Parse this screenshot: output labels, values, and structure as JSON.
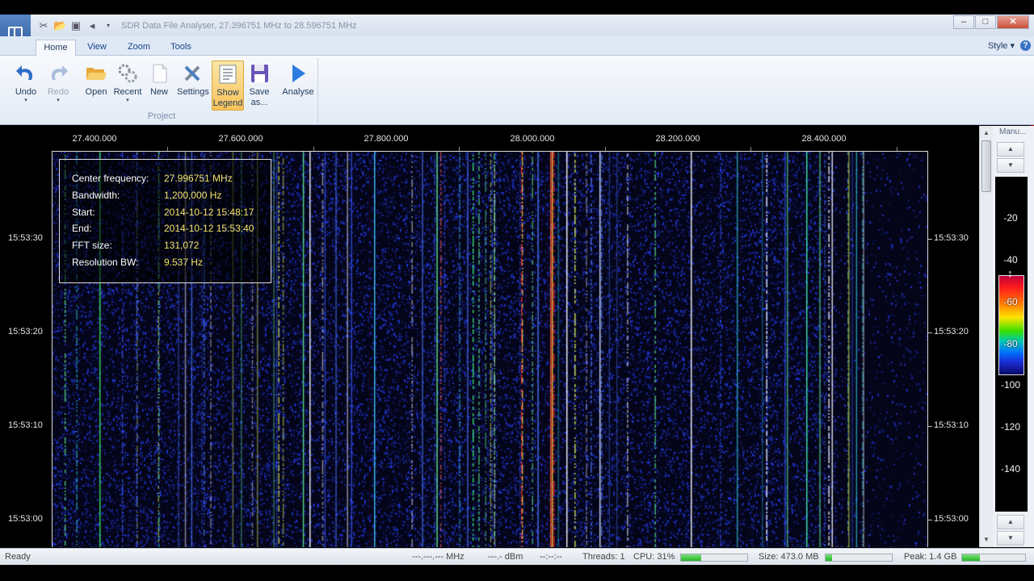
{
  "window": {
    "title": "SDR Data File Analyser, 27.396751 MHz to 28.596751 MHz",
    "controls": {
      "minimize": "–",
      "maximize": "□",
      "close": "✕"
    }
  },
  "quick_access": [
    "settings-icon",
    "open-icon",
    "save-icon",
    "sound-icon",
    "dropdown-icon"
  ],
  "tabs": [
    {
      "label": "Home",
      "active": true
    },
    {
      "label": "View",
      "active": false
    },
    {
      "label": "Zoom",
      "active": false
    },
    {
      "label": "Tools",
      "active": false
    }
  ],
  "style_menu": {
    "label": "Style",
    "arrow": "▾"
  },
  "help": "?",
  "ribbon": {
    "group_label": "Project",
    "buttons": {
      "undo": {
        "label": "Undo",
        "icon": "undo-icon"
      },
      "redo": {
        "label": "Redo",
        "icon": "redo-icon"
      },
      "open": {
        "label": "Open",
        "icon": "folder-open-icon"
      },
      "recent": {
        "label": "Recent",
        "icon": "recent-gears-icon"
      },
      "new": {
        "label": "New",
        "icon": "new-document-icon"
      },
      "settings": {
        "label": "Settings",
        "icon": "tools-icon"
      },
      "show_legend": {
        "label1": "Show",
        "label2": "Legend",
        "icon": "legend-icon",
        "pressed": true
      },
      "save_as": {
        "label1": "Save",
        "label2": "as...",
        "icon": "save-icon"
      },
      "analyse": {
        "label": "Analyse",
        "icon": "play-icon"
      }
    }
  },
  "spectrum": {
    "freq_ticks": [
      "27.400.000",
      "27.600.000",
      "27.800.000",
      "28.000.000",
      "28.200.000",
      "28.400.000"
    ],
    "time_ticks": [
      "15:53:30",
      "15:53:20",
      "15:53:10",
      "15:53:00"
    ],
    "background": "#06061e"
  },
  "legend": {
    "rows": [
      {
        "key": "Center frequency:",
        "value": "27.996751 MHz"
      },
      {
        "key": "Bandwidth:",
        "value": "1,200,000 Hz"
      },
      {
        "key": "Start:",
        "value": "2014-10-12 15:48:17"
      },
      {
        "key": "End:",
        "value": "2014-10-12 15:53:40"
      },
      {
        "key": "FFT size:",
        "value": "131,072"
      },
      {
        "key": "Resolution BW:",
        "value": "9.537 Hz"
      }
    ]
  },
  "scale": {
    "mode": "Manu...",
    "labels": [
      "-20",
      "-40",
      "-60",
      "-80",
      "-100",
      "-120",
      "-140"
    ]
  },
  "status": {
    "ready": "Ready",
    "freq": "---.---.--- MHz",
    "level": "---.- dBm",
    "time": "--:--:--",
    "threads": "Threads: 1",
    "cpu": "CPU: 31%",
    "cpu_fraction": 0.31,
    "size": "Size: 473.0 MB",
    "size_fraction": 0.1,
    "peak": "Peak: 1.4 GB",
    "peak_fraction": 0.28
  },
  "colors": {
    "legend_value": "#f2e36c",
    "pressed_button": "#f8c25a",
    "accent": "#15428b"
  }
}
